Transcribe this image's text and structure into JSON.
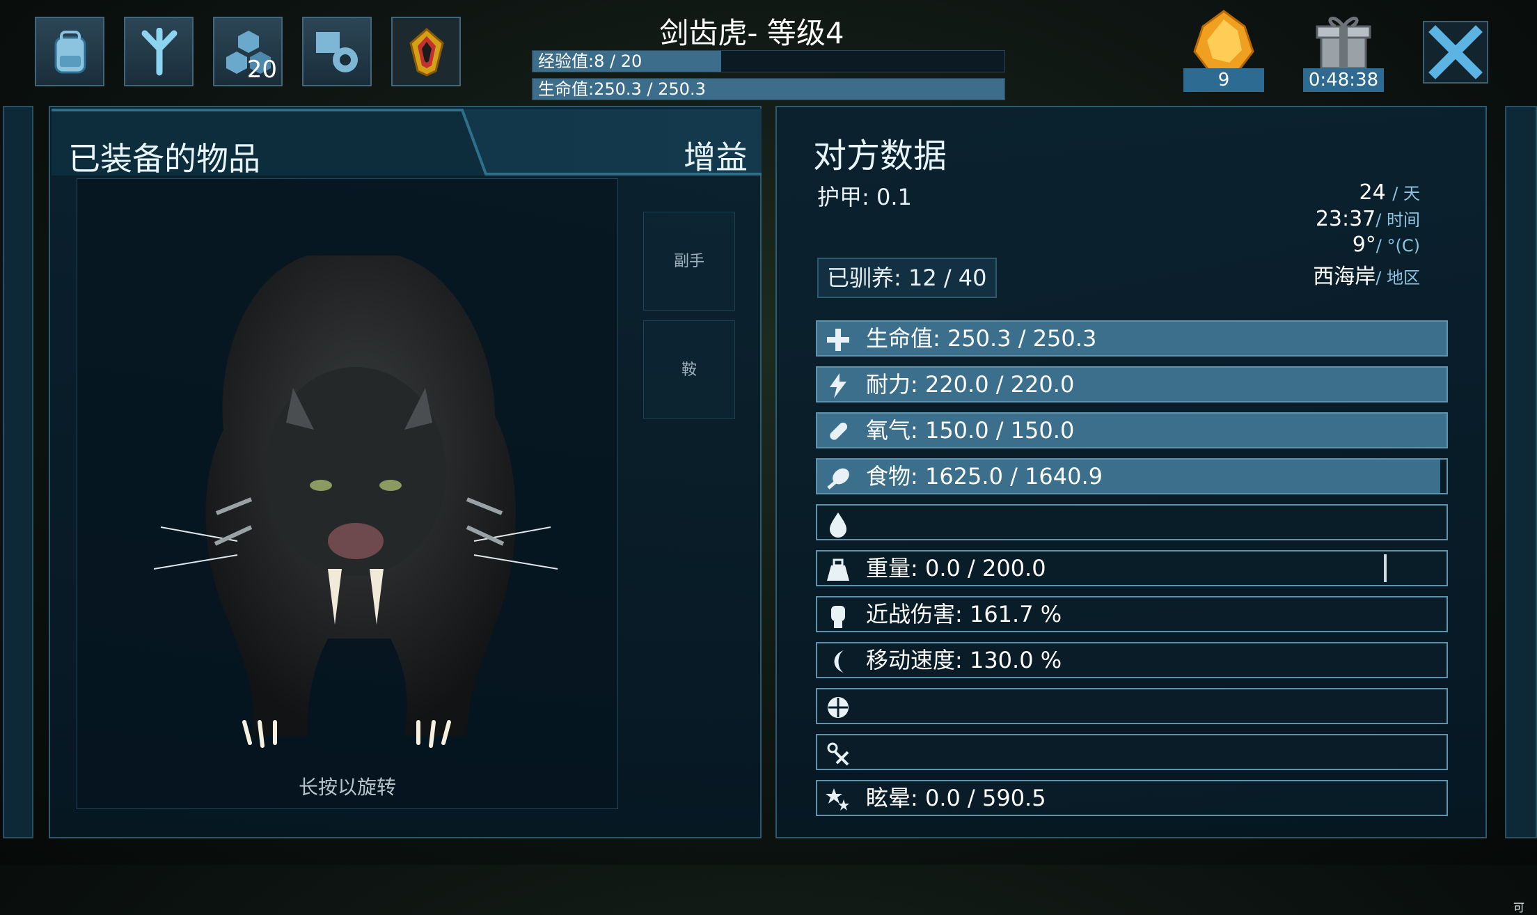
{
  "header": {
    "title": "剑齿虎- 等级4",
    "xp_label": "经验值:8 / 20",
    "xp_fraction": 0.4,
    "health_label": "生命值:250.3 / 250.3",
    "health_fraction": 1.0
  },
  "toolbar": {
    "buttons": [
      {
        "name": "inventory-button",
        "icon": "backpack-icon"
      },
      {
        "name": "tame-button",
        "icon": "dino-footprint-icon"
      },
      {
        "name": "engrams-button",
        "icon": "hexagon-cluster-icon",
        "badge": "20"
      },
      {
        "name": "settings-button",
        "icon": "book-gear-icon"
      },
      {
        "name": "tribe-button",
        "icon": "crystal-emblem-icon"
      }
    ],
    "amber_count": "9",
    "gift_timer": "0:48:38"
  },
  "left_panel": {
    "title": "已装备的物品",
    "tab_buffs": "增益",
    "slots": [
      "副手",
      "鞍"
    ],
    "rotate_hint": "长按以旋转"
  },
  "right_panel": {
    "title": "对方数据",
    "armor": "护甲: 0.1",
    "tamed": "已驯养: 12 / 40",
    "day_value": "24",
    "day_unit": "/ 天",
    "time_value": "23:37",
    "time_unit": "/ 时间",
    "temp_value": "9°",
    "temp_unit": "/ °(C)",
    "region_value": "西海岸",
    "region_unit": "/ 地区",
    "stats": [
      {
        "icon": "health-cross-icon",
        "label": "生命值: 250.3 / 250.3",
        "fill": 1.0
      },
      {
        "icon": "stamina-bolt-icon",
        "label": "耐力: 220.0 / 220.0",
        "fill": 1.0
      },
      {
        "icon": "oxygen-tank-icon",
        "label": "氧气: 150.0 / 150.0",
        "fill": 1.0
      },
      {
        "icon": "food-drumstick-icon",
        "label": "食物: 1625.0 / 1640.9",
        "fill": 0.99
      },
      {
        "icon": "water-drop-icon",
        "label": "",
        "fill": 0
      },
      {
        "icon": "weight-icon",
        "label": "重量: 0.0 / 200.0",
        "fill": 0
      },
      {
        "icon": "melee-fist-icon",
        "label": "近战伤害: 161.7 %",
        "fill": 0
      },
      {
        "icon": "movement-speed-icon",
        "label": "移动速度: 130.0 %",
        "fill": 0
      },
      {
        "icon": "fortitude-icon",
        "label": "",
        "fill": 0
      },
      {
        "icon": "crafting-skill-icon",
        "label": "",
        "fill": 0
      },
      {
        "icon": "torpor-icon",
        "label": "眩晕: 0.0 / 590.5",
        "fill": 0
      }
    ]
  },
  "edge_label": "可",
  "colors": {
    "bar_fill": "#3b6f8c",
    "panel_border": "#2f5a6e",
    "accent_text": "#8fc3e0"
  }
}
